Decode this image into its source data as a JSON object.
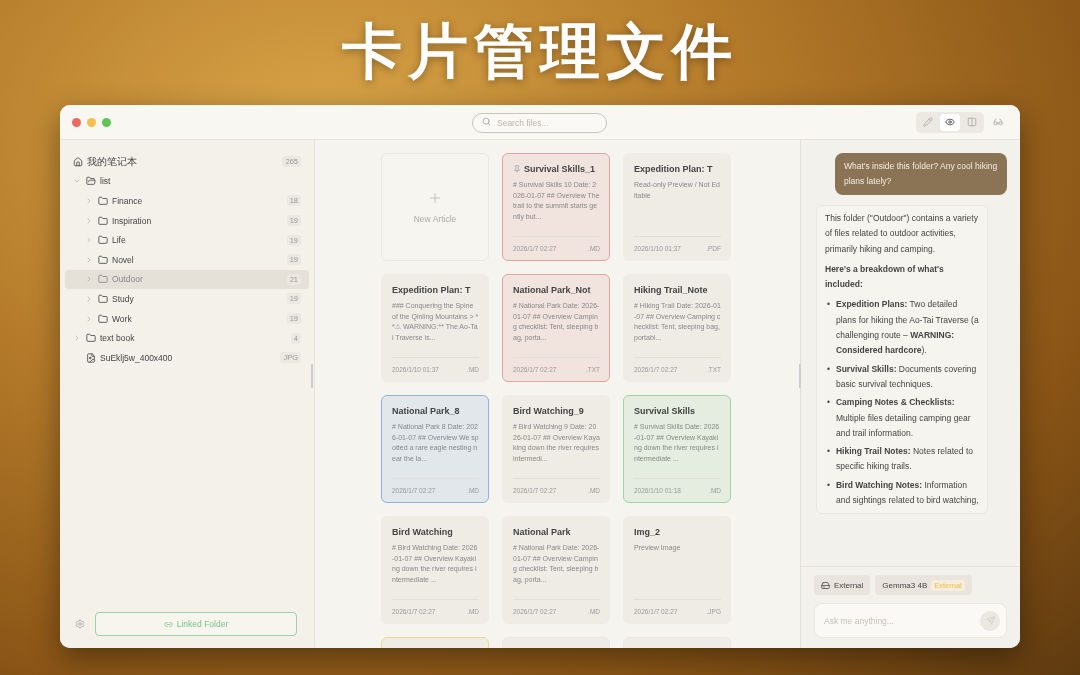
{
  "headline": "卡片管理文件",
  "traffic_lights": [
    {
      "color": "#ec6a5e"
    },
    {
      "color": "#f4bf4f"
    },
    {
      "color": "#61c554"
    }
  ],
  "search": {
    "placeholder": "Search files..."
  },
  "view_modes": [
    {
      "kind": "edit",
      "selected": false
    },
    {
      "kind": "preview",
      "selected": true
    },
    {
      "kind": "split",
      "selected": false
    }
  ],
  "sidebar": {
    "tree": [
      {
        "kind": "root",
        "label": "我的笔记本",
        "count": "265"
      },
      {
        "kind": "folder",
        "label": "list",
        "expanded": true,
        "children": [
          {
            "kind": "folder",
            "label": "Finance",
            "count": "18",
            "expanded": false,
            "selected": false
          },
          {
            "kind": "folder",
            "label": "Inspiration",
            "count": "19",
            "expanded": false,
            "selected": false
          },
          {
            "kind": "folder",
            "label": "Life",
            "count": "19",
            "expanded": false,
            "selected": false
          },
          {
            "kind": "folder",
            "label": "Novel",
            "count": "19",
            "expanded": false,
            "selected": false
          },
          {
            "kind": "folder",
            "label": "Outdoor",
            "count": "21",
            "expanded": false,
            "selected": true
          },
          {
            "kind": "folder",
            "label": "Study",
            "count": "19",
            "expanded": false,
            "selected": false
          },
          {
            "kind": "folder",
            "label": "Work",
            "count": "19",
            "expanded": false,
            "selected": false
          }
        ]
      },
      {
        "kind": "folder",
        "label": "text book",
        "count": "4",
        "expanded": false
      },
      {
        "kind": "file",
        "label": "SuEklj5w_400x400",
        "count": "JPG"
      }
    ],
    "linked_folder": "Linked Folder"
  },
  "new_article": "New Article",
  "cards": [
    {
      "title": "Survival Skills_1",
      "pinned": true,
      "preview": "# Survival Skills 10 Date: 2026-01-07 ## Overview The trail to the summit starts gently but...",
      "date": "2026/1/7 02:27",
      "type": ".MD",
      "color": "#e3a3a3"
    },
    {
      "title": "Expedition Plan: T",
      "pinned": false,
      "preview": "Read-only Preview / Not Editable",
      "date": "2026/1/10 01:37",
      "type": ".PDF"
    },
    {
      "title": "Expedition Plan: T",
      "pinned": false,
      "preview": "### Conquering the Spine of the Qinling Mountains > **⚠ WARNING:** The Ao-Tai Traverse is...",
      "date": "2026/1/10 01:37",
      "type": ".MD"
    },
    {
      "title": "National Park_Not",
      "pinned": false,
      "preview": "# National Park Date: 2026-01-07 ## Overview Camping checklist: Tent, sleeping bag, porta...",
      "date": "2026/1/7 02:27",
      "type": ".TXT",
      "color": "#e3a3a3"
    },
    {
      "title": "Hiking Trail_Note",
      "pinned": false,
      "preview": "# Hiking Trail Date: 2026-01-07 ## Overview Camping checklist: Tent, sleeping bag, portabl...",
      "date": "2026/1/7 02:27",
      "type": ".TXT"
    },
    {
      "title": "National Park_8",
      "pinned": false,
      "preview": "# National Park 8 Date: 2026-01-07 ## Overview We spotted a rare eagle nesting near the la...",
      "date": "2026/1/7 02:27",
      "type": ".MD",
      "color": "#8fb3dc"
    },
    {
      "title": "Bird Watching_9",
      "pinned": false,
      "preview": "# Bird Watching 9 Date: 2026-01-07 ## Overview Kayaking down the river requires intermedi...",
      "date": "2026/1/7 02:27",
      "type": ".MD"
    },
    {
      "title": "Survival Skills",
      "pinned": false,
      "preview": "# Survival Skills Date: 2026-01-07 ## Overview Kayaking down the river requires intermediate ...",
      "date": "2026/1/10 01:18",
      "type": ".MD",
      "color": "#9fd4a6"
    },
    {
      "title": "Bird Watching",
      "pinned": false,
      "preview": "# Bird Watching Date: 2026-01-07 ## Overview Kayaking down the river requires intermediate ...",
      "date": "2026/1/7 02:27",
      "type": ".MD"
    },
    {
      "title": "National Park",
      "pinned": false,
      "preview": "# National Park Date: 2026-01-07 ## Overview Camping checklist: Tent, sleeping bag, porta...",
      "date": "2026/1/7 02:27",
      "type": ".MD"
    },
    {
      "title": "Img_2",
      "pinned": false,
      "preview": "Preview Image",
      "date": "2026/1/7 02:27",
      "type": ".JPG"
    }
  ],
  "partial_cards": [
    {
      "color": "#efd98f"
    },
    {
      "color": "#ebe7e0"
    },
    {
      "color": "#ebe7e0"
    }
  ],
  "chat": {
    "user_message": "What's inside this folder? Any cool hiking plans lately?",
    "intro": "This folder (\"Outdoor\") contains a variety of files related to outdoor activities, primarily hiking and camping.",
    "heading": "Here's a breakdown of what's included:",
    "bullet_marker": "•",
    "bullets": [
      "**Expedition Plans:** Two detailed plans for hiking the Ao-Tai Traverse (a challenging route – **WARNING: Considered hardcore**).",
      "**Survival Skills:** Documents covering basic survival techniques.",
      "**Camping Notes & Checklists:** Multiple files detailing camping gear and trail information.",
      "**Hiking Trail Notes:** Notes related to specific hiking trails.",
      "**Bird Watching Notes:** Information and sightings related to bird watching,"
    ],
    "source": "External",
    "model": "Gemma3 4B",
    "model_badge": "External",
    "input_placeholder": "Ask me anything..."
  }
}
